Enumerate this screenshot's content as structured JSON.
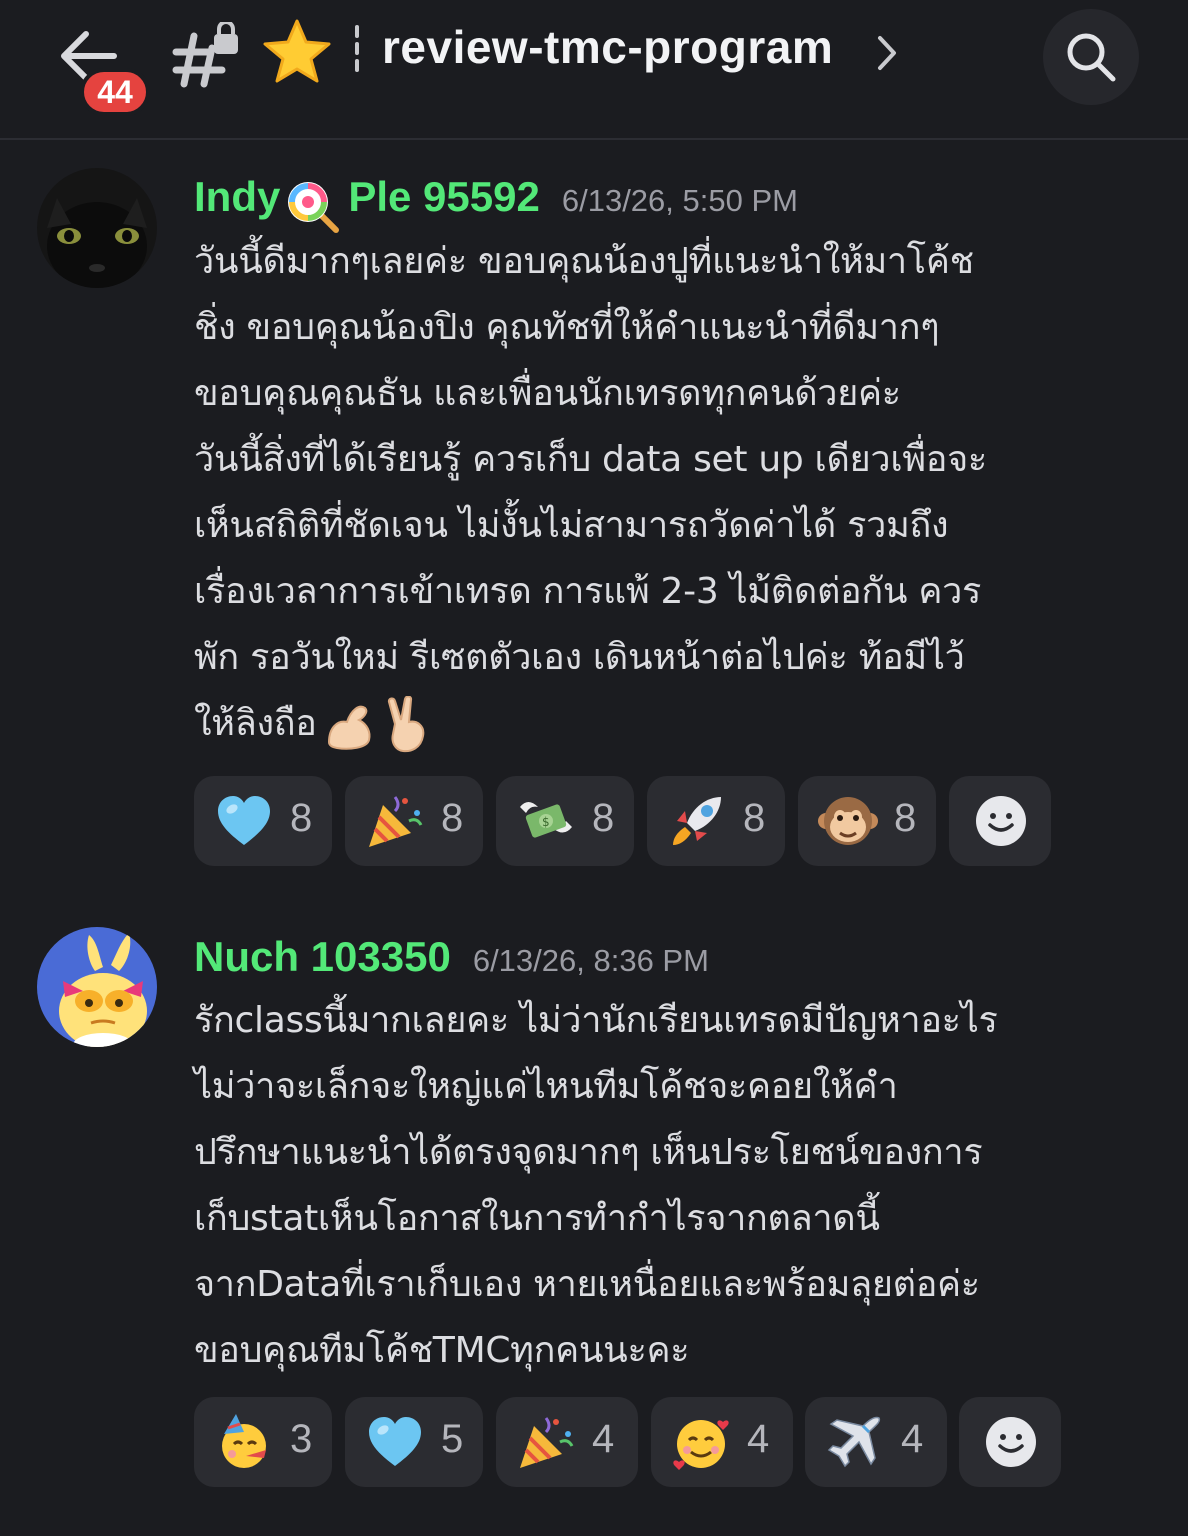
{
  "header": {
    "back_label": "back",
    "unread_badge": "44",
    "channel_name": "review-tmc-program",
    "icons": [
      "back-arrow-icon",
      "locked-threads-icon",
      "star-icon",
      "chevron-right-icon",
      "search-icon"
    ]
  },
  "messages": [
    {
      "author": "Indy",
      "author_suffix": "Ple 95592",
      "author_emoji": "lollipop-icon",
      "timestamp": "6/13/26, 5:50 PM",
      "text": "วันนี้ดีมากๆเลยค่ะ ขอบคุณน้องปูที่แนะนำให้มาโค้ช\nชิ่ง ขอบคุณน้องปิง คุณทัชที่ให้คำแนะนำที่ดีมากๆ\nขอบคุณคุณธัน และเพื่อนนักเทรดทุกคนด้วยค่ะ\nวันนี้สิ่งที่ได้เรียนรู้ ควรเก็บ data set up เดียวเพื่อจะ\nเห็นสถิติที่ชัดเจน ไม่งั้นไม่สามารถวัดค่าได้ รวมถึง\nเรื่องเวลาการเข้าเทรด  การแพ้ 2-3 ไม้ติดต่อกัน ควร\nพัก รอวันใหม่ รีเซตตัวเอง เดินหน้าต่อไปค่ะ ท้อมีไว้\nให้ลิงถือ",
      "trailing_emojis": [
        "flexed-biceps-icon",
        "victory-hand-icon"
      ],
      "reactions": [
        {
          "emoji": "blue-heart-icon",
          "count": "8"
        },
        {
          "emoji": "party-popper-icon",
          "count": "8"
        },
        {
          "emoji": "money-with-wings-icon",
          "count": "8"
        },
        {
          "emoji": "rocket-icon",
          "count": "8"
        },
        {
          "emoji": "monkey-face-icon",
          "count": "8"
        }
      ]
    },
    {
      "author": "Nuch 103350",
      "timestamp": "6/13/26, 8:36 PM",
      "text": "รักclassนี้มากเลยคะ ไม่ว่านักเรียนเทรดมีปัญหาอะไร\nไม่ว่าจะเล็กจะใหญ่แค่ไหนทีมโค้ชจะคอยให้คำ\nปรึกษาแนะนำได้ตรงจุดมากๆ  เห็นประโยชน์ของการ\nเก็บstatเห็นโอกาสในการทำกำไรจากตลาดนี้\nจากDataที่เราเก็บเอง หายเหนื่อยและพร้อมลุยต่อค่ะ\nขอบคุณทีมโค้ชTMCทุกคนนะคะ",
      "reactions": [
        {
          "emoji": "partying-face-icon",
          "count": "3"
        },
        {
          "emoji": "blue-heart-icon",
          "count": "5"
        },
        {
          "emoji": "party-popper-icon",
          "count": "4"
        },
        {
          "emoji": "smiling-face-with-hearts-icon",
          "count": "4"
        },
        {
          "emoji": "airplane-icon",
          "count": "4"
        }
      ]
    }
  ],
  "colors": {
    "background": "#1b1c20",
    "author_name": "#53e878",
    "badge": "#e5433f",
    "reaction_bg": "#2b2c31",
    "timestamp": "#9b9ca4"
  }
}
